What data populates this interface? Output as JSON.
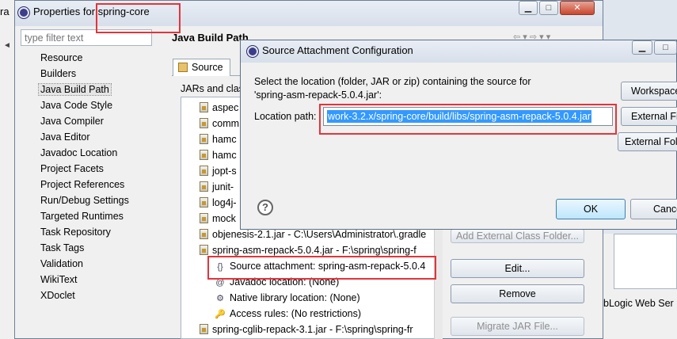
{
  "background_left_fragment": "ra",
  "properties": {
    "title": "Properties for spring-core",
    "filter_placeholder": "type filter text",
    "nav_items": [
      "Resource",
      "Builders",
      "Java Build Path",
      "Java Code Style",
      "Java Compiler",
      "Java Editor",
      "Javadoc Location",
      "Project Facets",
      "Project References",
      "Run/Debug Settings",
      "Targeted Runtimes",
      "Task Repository",
      "Task Tags",
      "Validation",
      "WikiText",
      "XDoclet"
    ],
    "selected_nav": "Java Build Path",
    "panel_title": "Java Build Path",
    "tab_source": "Source",
    "jars_label": "JARs and clas",
    "tree_items": [
      {
        "label": "aspec",
        "type": "jar"
      },
      {
        "label": "comm",
        "type": "jar"
      },
      {
        "label": "hamc",
        "type": "jar"
      },
      {
        "label": "hamc",
        "type": "jar"
      },
      {
        "label": "jopt-s",
        "type": "jar"
      },
      {
        "label": "junit-",
        "type": "jar"
      },
      {
        "label": "log4j-",
        "type": "jar"
      },
      {
        "label": "mock",
        "type": "jar"
      },
      {
        "label": "objenesis-2.1.jar - C:\\Users\\Administrator\\.gradle",
        "type": "jar"
      },
      {
        "label": "spring-asm-repack-5.0.4.jar - F:\\spring\\spring-f",
        "type": "jar"
      },
      {
        "label": "Source attachment: spring-asm-repack-5.0.4",
        "type": "source"
      },
      {
        "label": "Javadoc location: (None)",
        "type": "javadoc"
      },
      {
        "label": "Native library location: (None)",
        "type": "native"
      },
      {
        "label": "Access rules: (No restrictions)",
        "type": "access"
      },
      {
        "label": "spring-cglib-repack-3.1.jar - F:\\spring\\spring-fr",
        "type": "jar"
      }
    ],
    "buttons": {
      "add_external_class_folder": "Add External Class Folder...",
      "edit": "Edit...",
      "remove": "Remove",
      "migrate": "Migrate JAR File..."
    },
    "right_fragment": "bLogic Web Ser"
  },
  "dialog": {
    "title": "Source Attachment Configuration",
    "instruction_line1": "Select the location (folder, JAR or zip) containing the source for",
    "instruction_line2": "'spring-asm-repack-5.0.4.jar':",
    "location_label": "Location path:",
    "location_value": "work-3.2.x/spring-core/build/libs/spring-asm-repack-5.0.4.jar",
    "workspace_button": "Workspace...",
    "external_file_button": "External File...",
    "external_folder_button": "External Folder...",
    "ok_button": "OK",
    "cancel_button": "Cancel",
    "help_icon": "?"
  },
  "colors": {
    "highlight": "#e5333a",
    "selection": "#3399ff"
  }
}
